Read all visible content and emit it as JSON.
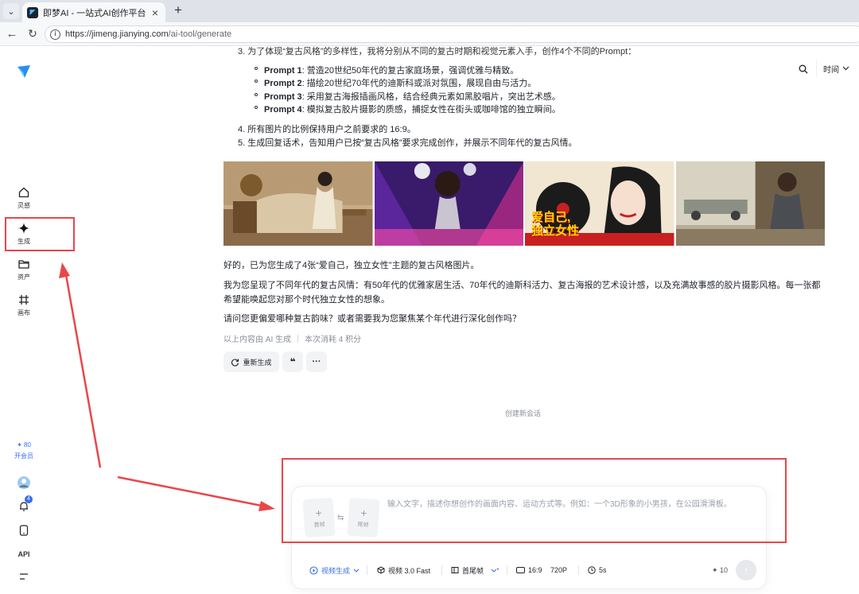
{
  "browser": {
    "tab_title": "即梦AI - 一站式AI创作平台",
    "tab_close": "×",
    "new_tab": "+",
    "url_host": "https://jimeng.jianying.com",
    "url_path": "/ai-tool/generate"
  },
  "sidebar": {
    "items": [
      {
        "label": "灵感",
        "icon": "home-icon"
      },
      {
        "label": "生成",
        "icon": "sparkle-icon"
      },
      {
        "label": "资产",
        "icon": "folder-icon"
      },
      {
        "label": "画布",
        "icon": "canvas-icon"
      }
    ],
    "credits": "✦ 80",
    "member": "开会员",
    "notif_count": "4",
    "api_label": "API"
  },
  "top_controls": {
    "sort_label": "时间"
  },
  "message": {
    "step3": "3. 为了体现“复古风格”的多样性，我将分别从不同的复古时期和视觉元素入手，创作4个不同的Prompt：",
    "prompts": [
      {
        "name": "Prompt 1",
        "text": ": 营造20世纪50年代的复古家庭场景，强调优雅与精致。"
      },
      {
        "name": "Prompt 2",
        "text": ": 描绘20世纪70年代的迪斯科或派对氛围，展现自由与活力。"
      },
      {
        "name": "Prompt 3",
        "text": ": 采用复古海报插画风格，结合经典元素如黑胶唱片，突出艺术感。"
      },
      {
        "name": "Prompt 4",
        "text": ": 模拟复古胶片摄影的质感，捕捉女性在街头或咖啡馆的独立瞬间。"
      }
    ],
    "step4": "4. 所有图片的比例保持用户之前要求的 16:9。",
    "step5": "5. 生成回复话术，告知用户已按“复古风格”要求完成创作，并展示不同年代的复古风情。",
    "poster_text_1": "爱自己,",
    "poster_text_2": "独立女性",
    "reply_1": "好的，已为您生成了4张“爱自己，独立女性”主题的复古风格图片。",
    "reply_2": "我为您呈现了不同年代的复古风情：有50年代的优雅家居生活、70年代的迪斯科活力、复古海报的艺术设计感，以及充满故事感的胶片摄影风格。每一张都希望能唤起您对那个时代独立女性的想象。",
    "reply_3": "请问您更偏爱哪种复古韵味？或者需要我为您聚焦某个年代进行深化创作吗？",
    "meta_ai": "以上内容由 AI 生成",
    "meta_cost": "本次消耗 4 积分",
    "regen_label": "重新生成",
    "quote_label": "❝",
    "more_label": "···",
    "new_session": "创建新会话"
  },
  "composer": {
    "first_frame": "首帧",
    "last_frame": "尾帧",
    "swap": "⇆",
    "placeholder": "输入文字，描述你想创作的画面内容、运动方式等。例如：一个3D形象的小男孩，在公园滑滑板。",
    "mode": "视频生成",
    "model": "视频 3.0 Fast",
    "frame_mode": "首尾帧",
    "ratio": "16:9",
    "resolution": "720P",
    "duration": "5s",
    "cost": "✦ 10",
    "send": "↑"
  },
  "colors": {
    "accent": "#3a6df0",
    "annotation": "#e8474a"
  }
}
